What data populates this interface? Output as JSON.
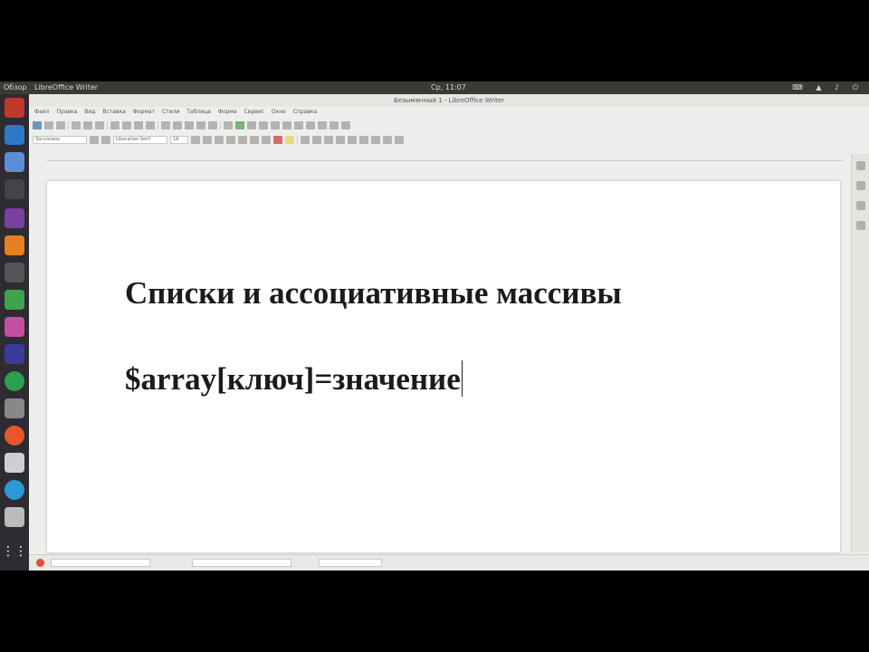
{
  "topbar": {
    "activities": "Обзор",
    "app_menu": "LibreOffice Writer",
    "clock": "Ср, 11:07",
    "tray_icons": [
      "keyboard-icon",
      "network-icon",
      "volume-icon",
      "power-icon"
    ]
  },
  "window": {
    "title": "Безымянный 1 - LibreOffice Writer"
  },
  "menubar": {
    "items": [
      "Файл",
      "Правка",
      "Вид",
      "Вставка",
      "Формат",
      "Стили",
      "Таблица",
      "Форма",
      "Сервис",
      "Окно",
      "Справка"
    ]
  },
  "toolbar2": {
    "style_value": "Заголовок",
    "font_value": "Liberation Serif",
    "size_value": "18"
  },
  "document": {
    "heading": "Списки и ассоциативные массивы",
    "code_line": "$array[ключ]=значение"
  },
  "colors": {
    "page": "#ffffff",
    "text": "#1b1b1b",
    "launcher": "#2e2b32",
    "topbar": "#3b3a37"
  }
}
